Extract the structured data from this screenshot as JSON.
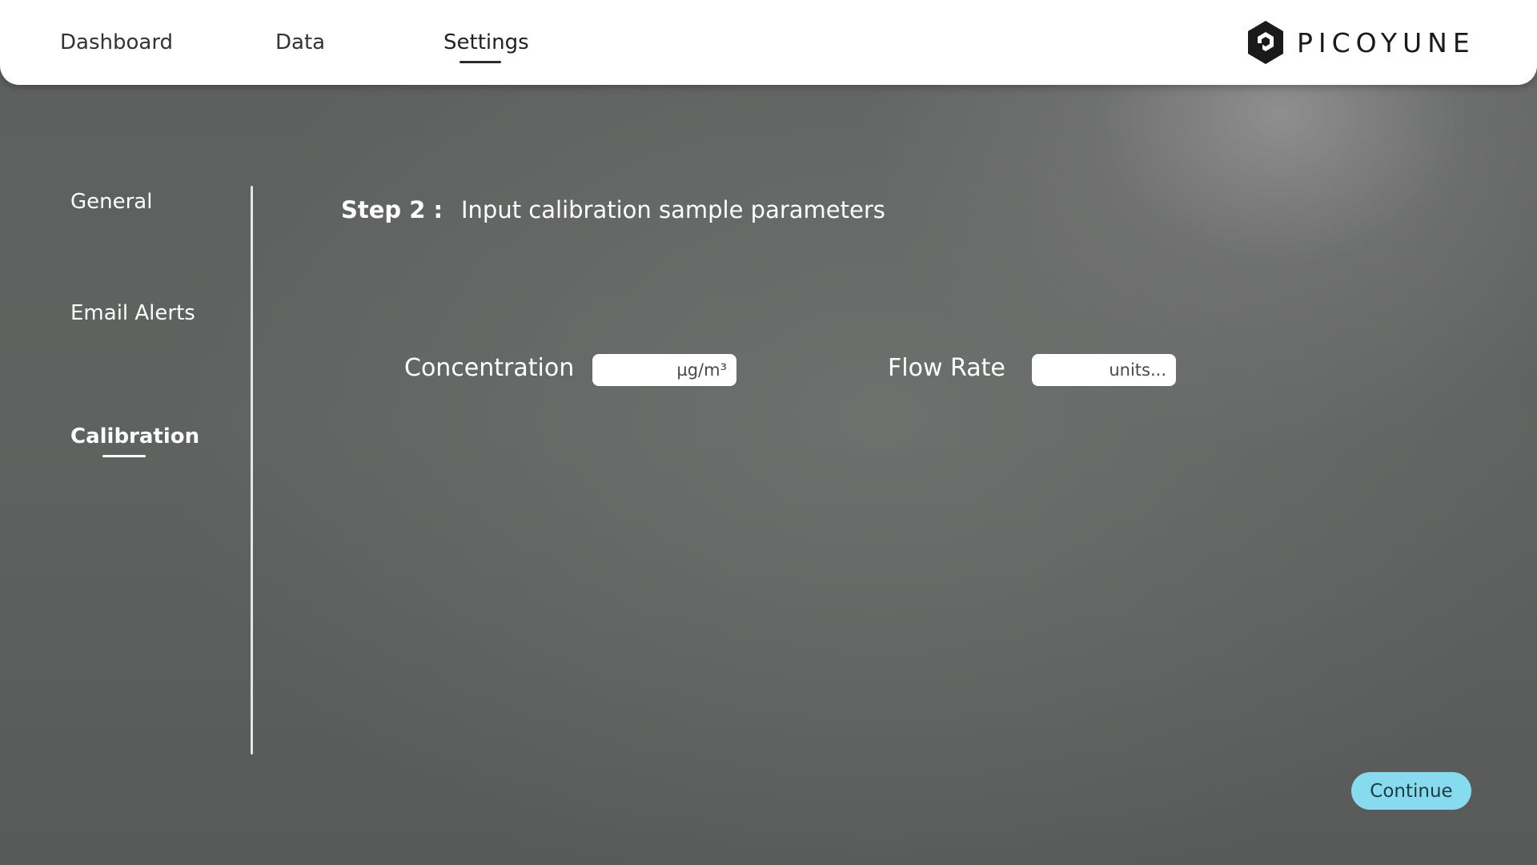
{
  "header": {
    "nav": [
      {
        "label": "Dashboard"
      },
      {
        "label": "Data"
      },
      {
        "label": "Settings",
        "active": true
      }
    ],
    "logo_text": "PICOYUNE"
  },
  "sidebar": {
    "items": [
      {
        "label": "General"
      },
      {
        "label": "Email Alerts"
      },
      {
        "label": "Calibration",
        "active": true
      }
    ]
  },
  "main": {
    "step_label": "Step 2 :",
    "step_text": "Input calibration sample parameters",
    "fields": [
      {
        "label": "Concentration",
        "value": "",
        "placeholder": "µg/m³"
      },
      {
        "label": "Flow Rate",
        "value": "",
        "placeholder": "units..."
      }
    ],
    "continue_label": "Continue"
  },
  "colors": {
    "accent": "#86dcee",
    "header_bg": "#ffffff",
    "background": "#5e605f"
  }
}
